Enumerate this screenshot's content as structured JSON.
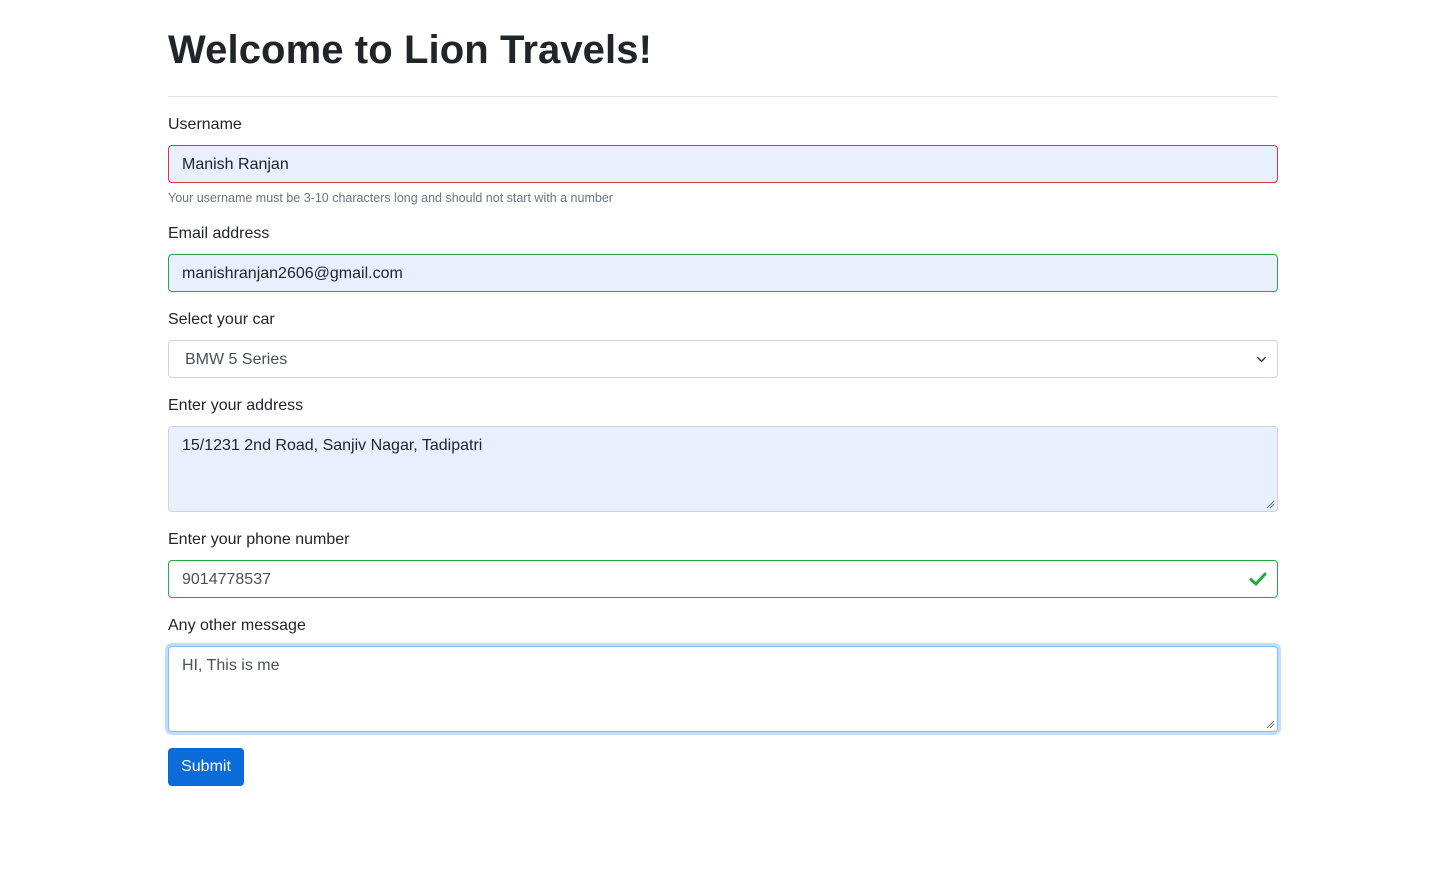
{
  "page": {
    "title": "Welcome to Lion Travels!"
  },
  "form": {
    "username": {
      "label": "Username",
      "value": "Manish Ranjan",
      "help": "Your username must be 3-10 characters long and should not start with a number",
      "state": "invalid"
    },
    "email": {
      "label": "Email address",
      "value": "manishranjan2606@gmail.com",
      "state": "valid"
    },
    "car": {
      "label": "Select your car",
      "selected": "BMW 5 Series"
    },
    "address": {
      "label": "Enter your address",
      "value": "15/1231 2nd Road, Sanjiv Nagar, Tadipatri"
    },
    "phone": {
      "label": "Enter your phone number",
      "value": "9014778537",
      "state": "valid",
      "status_icon": "check-icon"
    },
    "message": {
      "label": "Any other message",
      "value": "HI, This is me",
      "state": "focused"
    },
    "submit_label": "Submit"
  },
  "colors": {
    "primary": "#0a6cd8",
    "invalid": "#dc3545",
    "valid": "#28a745",
    "autofill_bg": "#e8f0fe",
    "focus": "#80bdff"
  }
}
